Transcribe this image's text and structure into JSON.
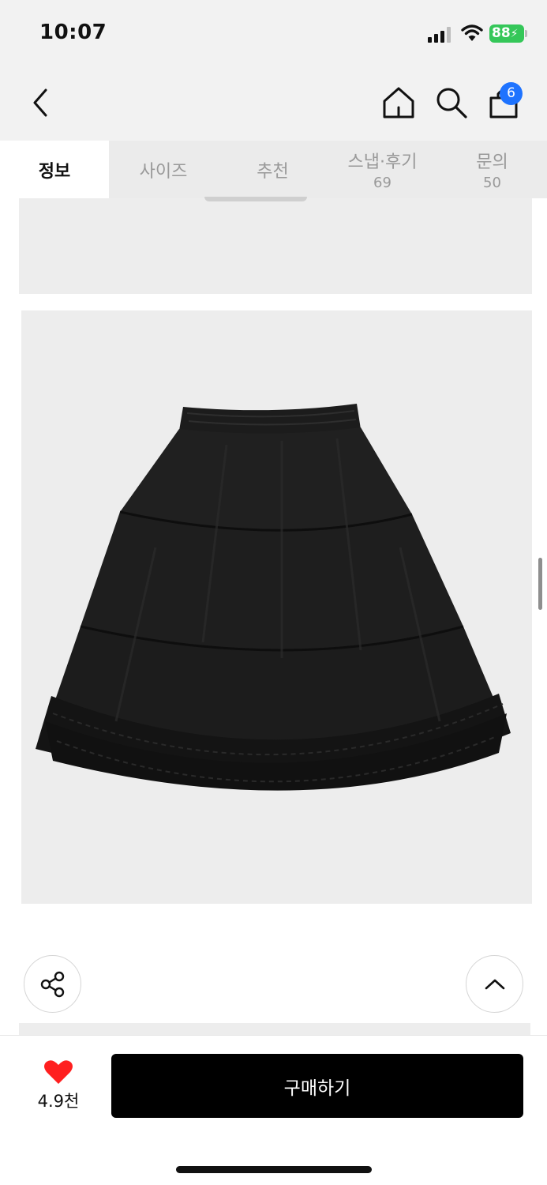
{
  "status_bar": {
    "time": "10:07",
    "battery": "88"
  },
  "header": {
    "back_icon": "chevron-left-icon",
    "home_icon": "home-icon",
    "search_icon": "search-icon",
    "cart_icon": "shopping-bag-icon",
    "cart_count": "6"
  },
  "tabs": [
    {
      "label": "정보",
      "count": ""
    },
    {
      "label": "사이즈",
      "count": ""
    },
    {
      "label": "추천",
      "count": ""
    },
    {
      "label": "스냅·후기",
      "count": "69"
    },
    {
      "label": "문의",
      "count": "50"
    }
  ],
  "floating": {
    "share_icon": "share-icon",
    "scroll_top_icon": "chevron-up-icon"
  },
  "bottom_bar": {
    "like_icon": "heart-icon",
    "like_count": "4.9천",
    "buy_label": "구매하기"
  },
  "colors": {
    "accent_badge": "#1e73ff",
    "heart": "#ff1f1f",
    "buy_button": "#000000",
    "battery": "#35c759"
  }
}
